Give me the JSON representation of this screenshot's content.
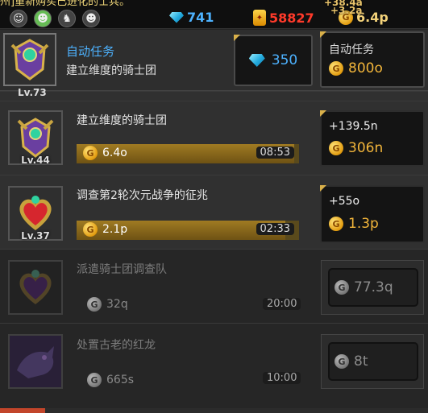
{
  "ticker": "州]重新购买已进化的士兵。",
  "floating": [
    "+38.4a",
    "+3.2a"
  ],
  "topbar": {
    "avatars": [
      "avatar-1",
      "avatar-2",
      "avatar-3",
      "avatar-4"
    ],
    "gems": "741",
    "medals": "58827",
    "coins": "6.4p"
  },
  "header": {
    "title": "自动任务",
    "subtitle": "建立维度的骑士团",
    "gem_cost": "350",
    "auto_label": "自动任务",
    "auto_cost": "800o"
  },
  "quests": [
    {
      "name": "",
      "level": "Lv.73",
      "locked": false
    },
    {
      "name": "建立维度的骑士团",
      "level": "Lv.44",
      "reward": "6.4o",
      "time": "08:53",
      "progress": 0.98,
      "upgrade_gain": "+139.5n",
      "upgrade_cost": "306n"
    },
    {
      "name": "调查第2轮次元战争的征兆",
      "level": "Lv.37",
      "reward": "2.1p",
      "time": "02:33",
      "progress": 0.94,
      "upgrade_gain": "+55o",
      "upgrade_cost": "1.3p"
    },
    {
      "name": "派遣骑士团调查队",
      "reward": "32q",
      "time": "20:00",
      "unlock_cost": "77.3q",
      "locked": true
    },
    {
      "name": "处置古老的红龙",
      "reward": "665s",
      "time": "10:00",
      "unlock_cost": "8t",
      "locked": true
    }
  ],
  "colors": {
    "accent_blue": "#2aa8ea",
    "gold": "#e3a51b",
    "medal_red": "#e63228",
    "highlight": "#4db2ff"
  }
}
